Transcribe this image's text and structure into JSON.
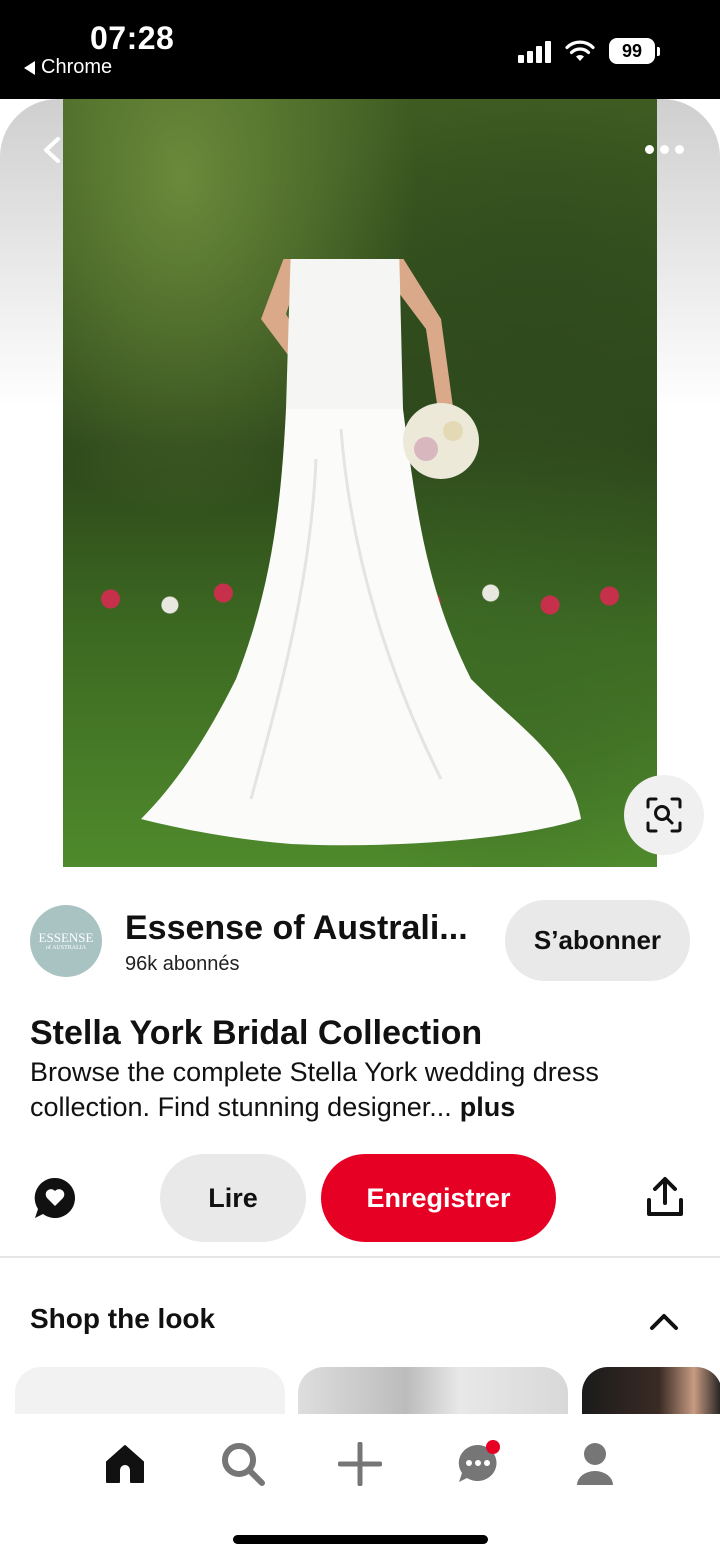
{
  "status_bar": {
    "time": "07:28",
    "back_app": "Chrome",
    "battery": "99",
    "icons": [
      "signal-icon",
      "wifi-icon",
      "battery-icon"
    ]
  },
  "hero": {
    "back_icon": "chevron-left-icon",
    "more_icon": "more-dots-icon",
    "lens_icon": "visual-search-icon"
  },
  "creator": {
    "avatar_line1": "ESSENSE",
    "avatar_line2": "of AUSTRALIA",
    "name": "Essense of Australi...",
    "followers": "96k abonnés",
    "follow_label": "S’abonner"
  },
  "pin": {
    "title": "Stella York Bridal Collection",
    "description": "Browse the complete Stella York wedding dress collection. Find stunning designer...",
    "more_label": "plus"
  },
  "actions": {
    "read_label": "Lire",
    "save_label": "Enregistrer",
    "comment_icon": "comment-icon",
    "share_icon": "share-icon"
  },
  "shop": {
    "title": "Shop the look",
    "chevron_icon": "chevron-up-icon"
  },
  "bottom_nav": {
    "items": [
      "home-icon",
      "search-icon",
      "plus-icon",
      "messages-icon",
      "profile-icon"
    ]
  },
  "colors": {
    "accent": "#e60023",
    "button_gray": "#e9e9e9",
    "avatar_bg": "#a9c3c3"
  }
}
